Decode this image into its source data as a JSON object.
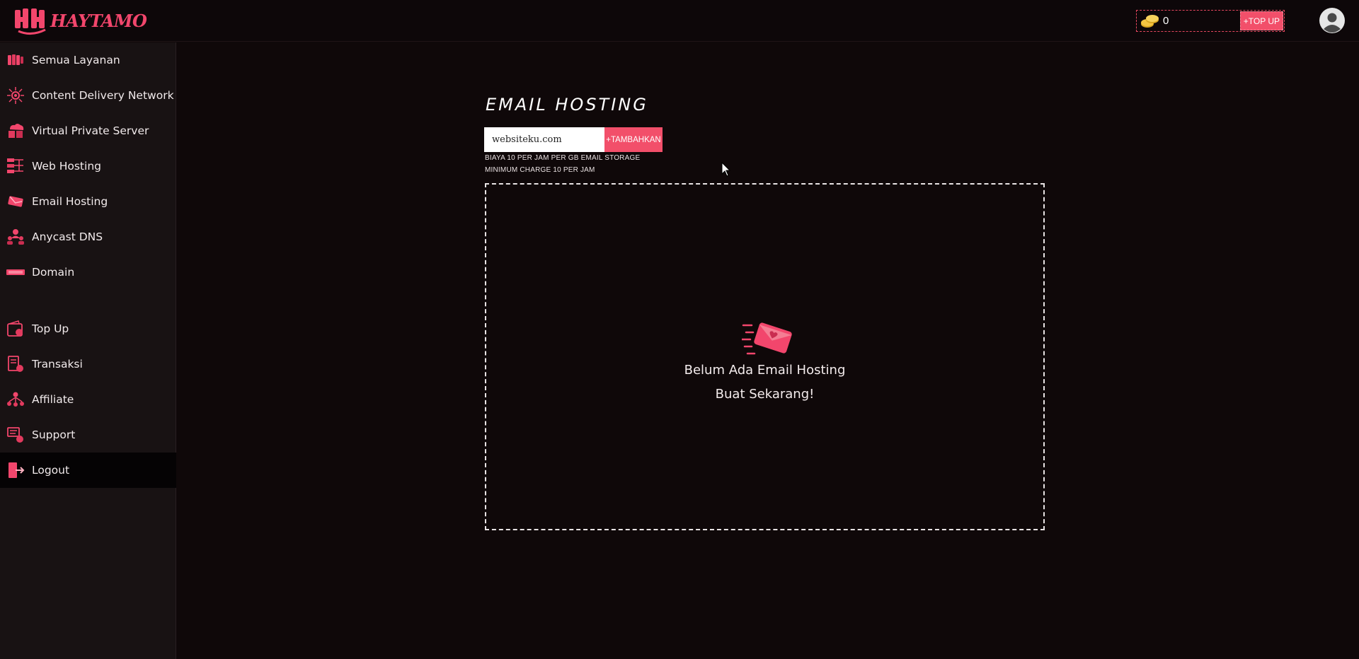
{
  "brand": {
    "logo_text": "HAYTAMO",
    "accent": "#f24f6a"
  },
  "header": {
    "balance_icon": "coins-icon",
    "balance_value": "0",
    "topup_label": "+TOP UP",
    "avatar_icon": "user-avatar-icon"
  },
  "sidebar": {
    "items": [
      {
        "label": "Semua Layanan",
        "icon": "services-icon"
      },
      {
        "label": "Content Delivery Network",
        "icon": "cdn-icon"
      },
      {
        "label": "Virtual Private Server",
        "icon": "vps-icon"
      },
      {
        "label": "Web Hosting",
        "icon": "web-hosting-icon"
      },
      {
        "label": "Email Hosting",
        "icon": "email-hosting-icon"
      },
      {
        "label": "Anycast DNS",
        "icon": "dns-icon"
      },
      {
        "label": "Domain",
        "icon": "domain-icon"
      },
      {
        "label": "Top Up",
        "icon": "wallet-icon"
      },
      {
        "label": "Transaksi",
        "icon": "transaction-icon"
      },
      {
        "label": "Affiliate",
        "icon": "affiliate-icon"
      },
      {
        "label": "Support",
        "icon": "support-icon"
      },
      {
        "label": "Logout",
        "icon": "logout-icon"
      }
    ]
  },
  "main": {
    "title": "EMAIL HOSTING",
    "domain_input": {
      "value": "websiteku.com",
      "placeholder": "websiteku.com"
    },
    "add_label": "+TAMBAHKAN",
    "fee_line_1": "BIAYA 10 PER JAM PER GB EMAIL STORAGE",
    "fee_line_2": "MINIMUM CHARGE 10 PER JAM",
    "empty_state": {
      "icon": "envelope-icon",
      "title": "Belum Ada Email Hosting",
      "cta": "Buat Sekarang!"
    }
  }
}
